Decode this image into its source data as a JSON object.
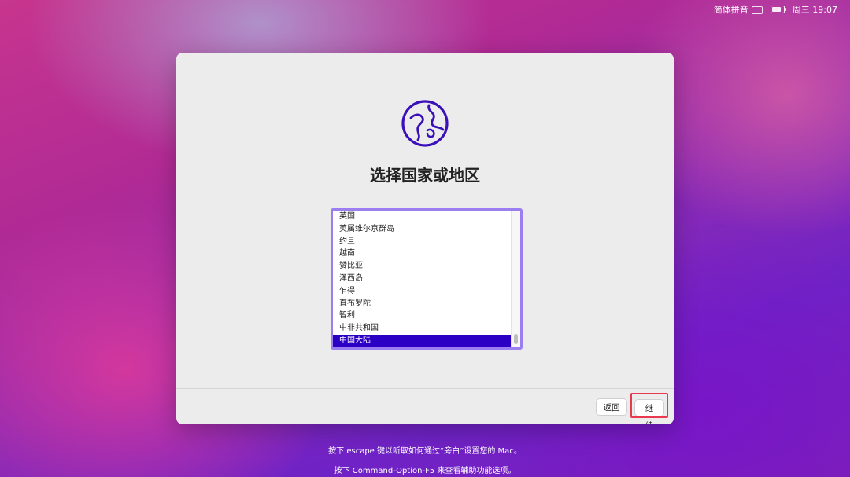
{
  "menubar": {
    "input_method": "简体拼音",
    "clock": "周三 19:07"
  },
  "window": {
    "title": "选择国家或地区",
    "countries": [
      "英国",
      "英属维尔京群岛",
      "约旦",
      "越南",
      "赞比亚",
      "泽西岛",
      "乍得",
      "直布罗陀",
      "智利",
      "中非共和国",
      "中国大陆"
    ],
    "selected": "中国大陆",
    "back_label": "返回",
    "continue_label": "继续"
  },
  "hints": {
    "line1": "按下 escape 键以听取如何通过“旁白”设置您的 Mac。",
    "line2": "按下 Command-Option-F5 来查看辅助功能选项。"
  },
  "colors": {
    "accent": "#2c00c4",
    "focus_ring": "#9b7ff0",
    "highlight_box": "#e8394f"
  },
  "icons": [
    "keyboard-icon",
    "battery-icon",
    "globe-icon"
  ]
}
